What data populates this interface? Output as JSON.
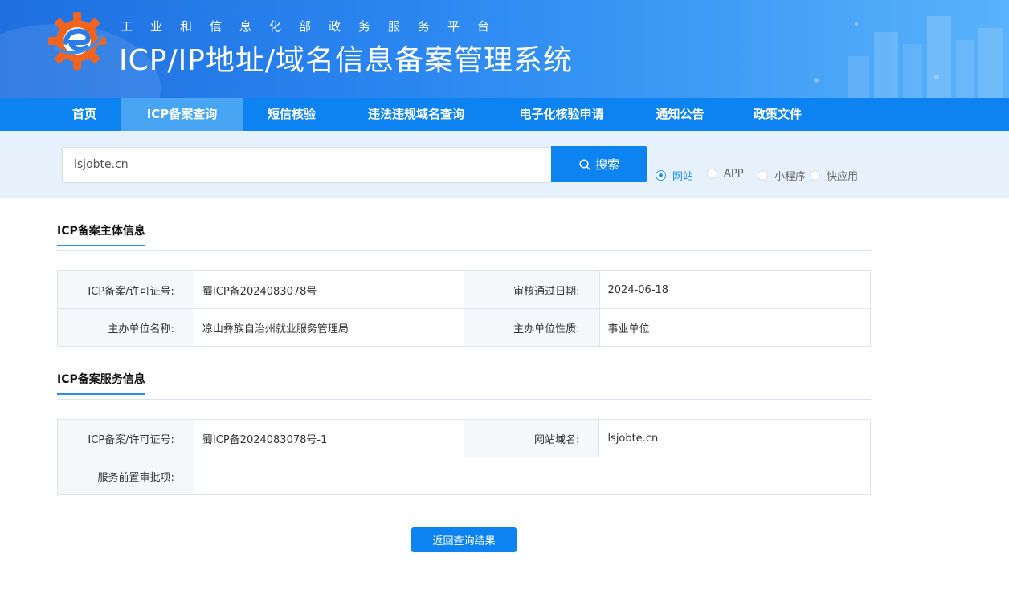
{
  "header": {
    "subtitle": "工业和信息化部政务服务平台",
    "title": "ICP/IP地址/域名信息备案管理系统",
    "logo_icon": "miit-gear-logo-icon"
  },
  "nav": {
    "items": [
      {
        "label": "首页",
        "active": false
      },
      {
        "label": "ICP备案查询",
        "active": true
      },
      {
        "label": "短信核验",
        "active": false
      },
      {
        "label": "违法违规域名查询",
        "active": false
      },
      {
        "label": "电子化核验申请",
        "active": false
      },
      {
        "label": "通知公告",
        "active": false
      },
      {
        "label": "政策文件",
        "active": false
      }
    ]
  },
  "search": {
    "value": "lsjobte.cn",
    "button_label": "搜索",
    "button_icon": "search-icon",
    "types": [
      {
        "label": "网站",
        "checked": true
      },
      {
        "label": "APP",
        "checked": false
      },
      {
        "label": "小程序",
        "checked": false
      },
      {
        "label": "快应用",
        "checked": false
      }
    ]
  },
  "subject_info": {
    "title": "ICP备案主体信息",
    "license_label": "ICP备案/许可证号:",
    "license_value": "蜀ICP备2024083078号",
    "approval_date_label": "审核通过日期:",
    "approval_date_value": "2024-06-18",
    "org_name_label": "主办单位名称:",
    "org_name_value": "凉山彝族自治州就业服务管理局",
    "org_type_label": "主办单位性质:",
    "org_type_value": "事业单位"
  },
  "service_info": {
    "title": "ICP备案服务信息",
    "license_label": "ICP备案/许可证号:",
    "license_value": "蜀ICP备2024083078号-1",
    "domain_label": "网站域名:",
    "domain_value": "lsjobte.cn",
    "pre_approval_label": "服务前置审批项:",
    "pre_approval_value": ""
  },
  "actions": {
    "back_label": "返回查询结果"
  },
  "colors": {
    "primary": "#0c83f0",
    "nav_active": "#48a5f3",
    "search_strip": "#e6f1fc"
  }
}
